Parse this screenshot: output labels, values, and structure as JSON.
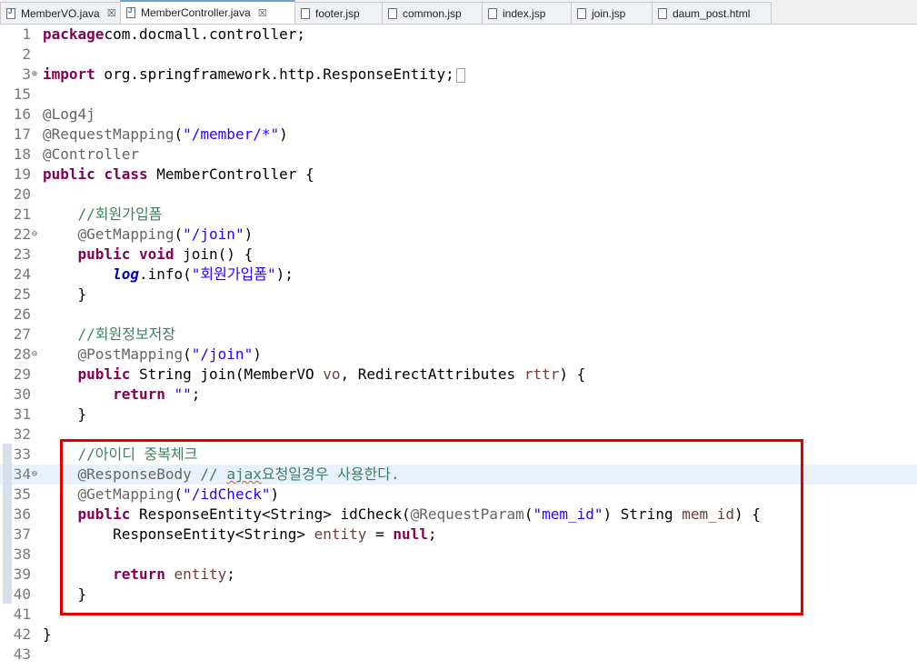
{
  "tabs": [
    {
      "label": "MemberVO.java",
      "icon": "java-file-icon",
      "closable": true,
      "active": false
    },
    {
      "label": "MemberController.java",
      "icon": "java-file-icon",
      "closable": true,
      "active": true
    },
    {
      "label": "footer.jsp",
      "icon": "file-icon",
      "closable": false,
      "active": false
    },
    {
      "label": "common.jsp",
      "icon": "file-icon",
      "closable": false,
      "active": false
    },
    {
      "label": "index.jsp",
      "icon": "file-icon",
      "closable": false,
      "active": false
    },
    {
      "label": "join.jsp",
      "icon": "file-icon",
      "closable": false,
      "active": false
    },
    {
      "label": "daum_post.html",
      "icon": "file-icon",
      "closable": false,
      "active": false
    }
  ],
  "close_glyph": "☒",
  "code_lines": [
    {
      "n": "1",
      "segs": [
        [
          "kw",
          "package"
        ],
        [
          "",
          "com.docmall.controller;"
        ]
      ]
    },
    {
      "n": "2",
      "segs": []
    },
    {
      "n": "3",
      "fold": "⊕",
      "collapsed": true,
      "segs": [
        [
          "kw",
          "import"
        ],
        [
          "",
          " org.springframework.http.ResponseEntity;"
        ]
      ]
    },
    {
      "n": "15",
      "segs": []
    },
    {
      "n": "16",
      "segs": [
        [
          "ann",
          "@Log4j"
        ]
      ]
    },
    {
      "n": "17",
      "segs": [
        [
          "ann",
          "@RequestMapping"
        ],
        [
          "",
          "("
        ],
        [
          "str",
          "\"/member/*\""
        ],
        [
          "",
          ")"
        ]
      ]
    },
    {
      "n": "18",
      "segs": [
        [
          "ann",
          "@Controller"
        ]
      ]
    },
    {
      "n": "19",
      "segs": [
        [
          "kw",
          "public"
        ],
        [
          "",
          " "
        ],
        [
          "kw",
          "class"
        ],
        [
          "",
          " MemberController {"
        ]
      ]
    },
    {
      "n": "20",
      "segs": []
    },
    {
      "n": "21",
      "segs": [
        [
          "",
          "    "
        ],
        [
          "cm",
          "//회원가입폼"
        ]
      ]
    },
    {
      "n": "22",
      "fold": "⊖",
      "segs": [
        [
          "",
          "    "
        ],
        [
          "ann",
          "@GetMapping"
        ],
        [
          "",
          "("
        ],
        [
          "str",
          "\"/join\""
        ],
        [
          "",
          ")"
        ]
      ]
    },
    {
      "n": "23",
      "segs": [
        [
          "",
          "    "
        ],
        [
          "kw",
          "public"
        ],
        [
          "",
          " "
        ],
        [
          "kw",
          "void"
        ],
        [
          "",
          " join() {"
        ]
      ]
    },
    {
      "n": "24",
      "segs": [
        [
          "",
          "        "
        ],
        [
          "field",
          "log"
        ],
        [
          "",
          ".info("
        ],
        [
          "str",
          "\"회원가입폼\""
        ],
        [
          "",
          ");"
        ]
      ]
    },
    {
      "n": "25",
      "segs": [
        [
          "",
          "    }"
        ]
      ]
    },
    {
      "n": "26",
      "segs": []
    },
    {
      "n": "27",
      "segs": [
        [
          "",
          "    "
        ],
        [
          "cm",
          "//회원정보저장"
        ]
      ]
    },
    {
      "n": "28",
      "fold": "⊖",
      "segs": [
        [
          "",
          "    "
        ],
        [
          "ann",
          "@PostMapping"
        ],
        [
          "",
          "("
        ],
        [
          "str",
          "\"/join\""
        ],
        [
          "",
          ")"
        ]
      ]
    },
    {
      "n": "29",
      "segs": [
        [
          "",
          "    "
        ],
        [
          "kw",
          "public"
        ],
        [
          "",
          " String join(MemberVO "
        ],
        [
          "var",
          "vo"
        ],
        [
          "",
          ", RedirectAttributes "
        ],
        [
          "var",
          "rttr"
        ],
        [
          "",
          ") {"
        ]
      ]
    },
    {
      "n": "30",
      "segs": [
        [
          "",
          "        "
        ],
        [
          "kw",
          "return"
        ],
        [
          "",
          " "
        ],
        [
          "str",
          "\"\""
        ],
        [
          "",
          ";"
        ]
      ]
    },
    {
      "n": "31",
      "segs": [
        [
          "",
          "    }"
        ]
      ]
    },
    {
      "n": "32",
      "segs": []
    },
    {
      "n": "33",
      "segs": [
        [
          "",
          "    "
        ],
        [
          "cm",
          "//아이디 중복체크"
        ]
      ]
    },
    {
      "n": "34",
      "fold": "⊖",
      "current": true,
      "segs": [
        [
          "",
          "    "
        ],
        [
          "ann",
          "@ResponseBody"
        ],
        [
          "",
          " "
        ],
        [
          "cm",
          "// "
        ],
        [
          "cm squig",
          "ajax"
        ],
        [
          "cm",
          "요청일경우 사용한다."
        ]
      ]
    },
    {
      "n": "35",
      "segs": [
        [
          "",
          "    "
        ],
        [
          "ann",
          "@GetMapping"
        ],
        [
          "",
          "("
        ],
        [
          "str",
          "\"/idCheck\""
        ],
        [
          "",
          ")"
        ]
      ]
    },
    {
      "n": "36",
      "segs": [
        [
          "",
          "    "
        ],
        [
          "kw",
          "public"
        ],
        [
          "",
          " ResponseEntity<String> idCheck("
        ],
        [
          "ann",
          "@RequestParam"
        ],
        [
          "",
          "("
        ],
        [
          "str",
          "\"mem_id\""
        ],
        [
          "",
          ") String "
        ],
        [
          "var",
          "mem_id"
        ],
        [
          "",
          ") {"
        ]
      ]
    },
    {
      "n": "37",
      "segs": [
        [
          "",
          "        ResponseEntity<String> "
        ],
        [
          "var",
          "entity"
        ],
        [
          "",
          " = "
        ],
        [
          "kw",
          "null"
        ],
        [
          "",
          ";"
        ]
      ]
    },
    {
      "n": "38",
      "segs": []
    },
    {
      "n": "39",
      "segs": [
        [
          "",
          "        "
        ],
        [
          "kw",
          "return"
        ],
        [
          "",
          " "
        ],
        [
          "var",
          "entity"
        ],
        [
          "",
          ";"
        ]
      ]
    },
    {
      "n": "40",
      "segs": [
        [
          "",
          "    }"
        ]
      ]
    },
    {
      "n": "41",
      "segs": []
    },
    {
      "n": "42",
      "segs": [
        [
          "",
          "}"
        ]
      ]
    },
    {
      "n": "43",
      "segs": []
    }
  ],
  "colors": {
    "keyword": "#7f0055",
    "string": "#2a00ff",
    "comment": "#3f7f5f",
    "annotation": "#646464",
    "highlight_border": "#e10000"
  }
}
